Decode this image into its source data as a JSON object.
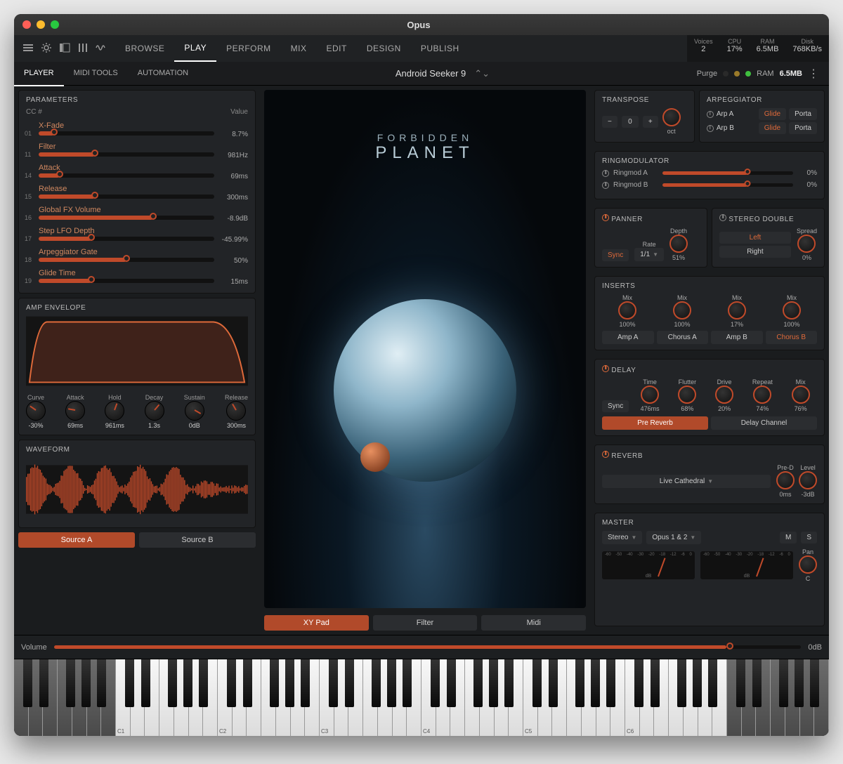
{
  "window": {
    "title": "Opus"
  },
  "toolbar": {
    "nav": [
      "BROWSE",
      "PLAY",
      "PERFORM",
      "MIX",
      "EDIT",
      "DESIGN",
      "PUBLISH"
    ],
    "nav_active": 1,
    "metrics": [
      {
        "label": "Voices",
        "value": "2"
      },
      {
        "label": "CPU",
        "value": "17%"
      },
      {
        "label": "RAM",
        "value": "6.5MB"
      },
      {
        "label": "Disk",
        "value": "768KB/s"
      }
    ]
  },
  "subbar": {
    "tabs": [
      "PLAYER",
      "MIDI TOOLS",
      "AUTOMATION"
    ],
    "tabs_active": 0,
    "preset": "Android Seeker 9",
    "purge_label": "Purge",
    "ram_label": "RAM",
    "ram_value": "6.5MB"
  },
  "parameters": {
    "title": "PARAMETERS",
    "header_cc": "CC #",
    "header_val": "Value",
    "rows": [
      {
        "cc": "01",
        "name": "X-Fade",
        "value": "8.7%",
        "pct": 8.7
      },
      {
        "cc": "11",
        "name": "Filter",
        "value": "981Hz",
        "pct": 32
      },
      {
        "cc": "14",
        "name": "Attack",
        "value": "69ms",
        "pct": 12
      },
      {
        "cc": "15",
        "name": "Release",
        "value": "300ms",
        "pct": 32
      },
      {
        "cc": "16",
        "name": "Global FX Volume",
        "value": "-8.9dB",
        "pct": 65
      },
      {
        "cc": "17",
        "name": "Step LFO Depth",
        "value": "-45.99%",
        "pct": 30
      },
      {
        "cc": "18",
        "name": "Arpeggiator Gate",
        "value": "50%",
        "pct": 50
      },
      {
        "cc": "19",
        "name": "Glide Time",
        "value": "15ms",
        "pct": 30
      }
    ]
  },
  "amp_env": {
    "title": "AMP ENVELOPE",
    "knobs": [
      {
        "label": "Curve",
        "value": "-30%",
        "ang": -55
      },
      {
        "label": "Attack",
        "value": "69ms",
        "ang": -80
      },
      {
        "label": "Hold",
        "value": "961ms",
        "ang": 20
      },
      {
        "label": "Decay",
        "value": "1.3s",
        "ang": 40
      },
      {
        "label": "Sustain",
        "value": "0dB",
        "ang": 120
      },
      {
        "label": "Release",
        "value": "300ms",
        "ang": -30
      }
    ]
  },
  "waveform": {
    "title": "WAVEFORM"
  },
  "sources": {
    "tabs": [
      "Source A",
      "Source B"
    ],
    "active": 0
  },
  "center": {
    "title_top": "FORBIDDEN",
    "title_bottom": "PLANET",
    "tabs": [
      "XY Pad",
      "Filter",
      "Midi"
    ],
    "tabs_active": 0
  },
  "transpose": {
    "title": "TRANSPOSE",
    "value": "0",
    "unit": "oct"
  },
  "arpeggiator": {
    "title": "ARPEGGIATOR",
    "rows": [
      {
        "name": "Arp A",
        "glide": "Glide",
        "porta": "Porta"
      },
      {
        "name": "Arp B",
        "glide": "Glide",
        "porta": "Porta"
      }
    ]
  },
  "ringmod": {
    "title": "RINGMODULATOR",
    "rows": [
      {
        "name": "Ringmod A",
        "value": "0%",
        "pct": 65
      },
      {
        "name": "Ringmod B",
        "value": "0%",
        "pct": 65
      }
    ]
  },
  "panner": {
    "title": "PANNER",
    "sync": "Sync",
    "rate_label": "Rate",
    "rate": "1/1",
    "depth_label": "Depth",
    "depth": "51%"
  },
  "stereo": {
    "title": "STEREO DOUBLE",
    "left": "Left",
    "right": "Right",
    "spread_label": "Spread",
    "spread": "0%"
  },
  "inserts": {
    "title": "INSERTS",
    "mix_label": "Mix",
    "items": [
      {
        "name": "Amp A",
        "mix": "100%"
      },
      {
        "name": "Chorus A",
        "mix": "100%"
      },
      {
        "name": "Amp B",
        "mix": "17%"
      },
      {
        "name": "Chorus B",
        "mix": "100%",
        "accent": true
      }
    ]
  },
  "delay": {
    "title": "DELAY",
    "sync": "Sync",
    "knobs": [
      {
        "label": "Time",
        "value": "476ms"
      },
      {
        "label": "Flutter",
        "value": "68%"
      },
      {
        "label": "Drive",
        "value": "20%"
      },
      {
        "label": "Repeat",
        "value": "74%"
      },
      {
        "label": "Mix",
        "value": "76%"
      }
    ],
    "tabs": [
      "Pre Reverb",
      "Delay Channel"
    ],
    "tabs_active": 0
  },
  "reverb": {
    "title": "REVERB",
    "preset": "Live Cathedral",
    "knobs": [
      {
        "label": "Pre-D",
        "value": "0ms"
      },
      {
        "label": "Level",
        "value": "-3dB"
      }
    ]
  },
  "master": {
    "title": "MASTER",
    "out1": "Stereo",
    "out2": "Opus 1 & 2",
    "m": "M",
    "s": "S",
    "pan_label": "Pan",
    "pan": "C",
    "vu_scale": [
      "-60",
      "-50",
      "-40",
      "-30",
      "-20",
      "-18",
      "-12",
      "-6",
      "0"
    ],
    "db": "dB",
    "vol_label": "Volume",
    "vol_value": "0dB",
    "vol_pct": 90
  },
  "keyboard": {
    "labels": [
      "C1",
      "C2",
      "C3",
      "C4",
      "C5",
      "C6"
    ]
  }
}
